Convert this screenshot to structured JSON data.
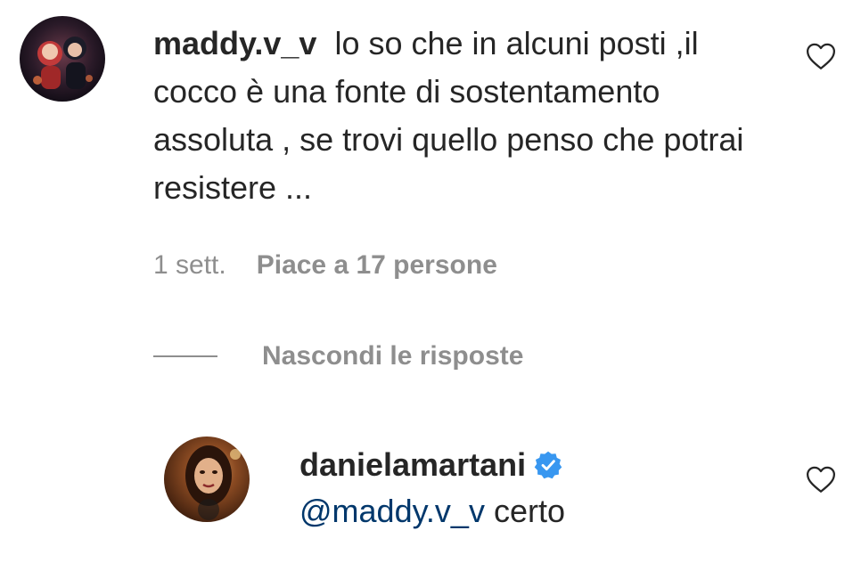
{
  "comment": {
    "username": "maddy.v_v",
    "text": "lo so che in alcuni posti ,il cocco è una fonte di sostentamento assoluta , se trovi quello penso che potrai resistere ...",
    "time": "1 sett.",
    "likes": "Piace a 17 persone",
    "like_icon": "heart-outline-icon"
  },
  "replies_toggle": {
    "label": "Nascondi le risposte"
  },
  "reply": {
    "username": "danielamartani",
    "verified": true,
    "verified_icon": "verified-badge-icon",
    "mention": "@maddy.v_v",
    "text": "certo",
    "like_icon": "heart-outline-icon"
  },
  "colors": {
    "text": "#262626",
    "secondary": "#8e8e8e",
    "mention": "#00376b",
    "verified": "#3897f0"
  }
}
